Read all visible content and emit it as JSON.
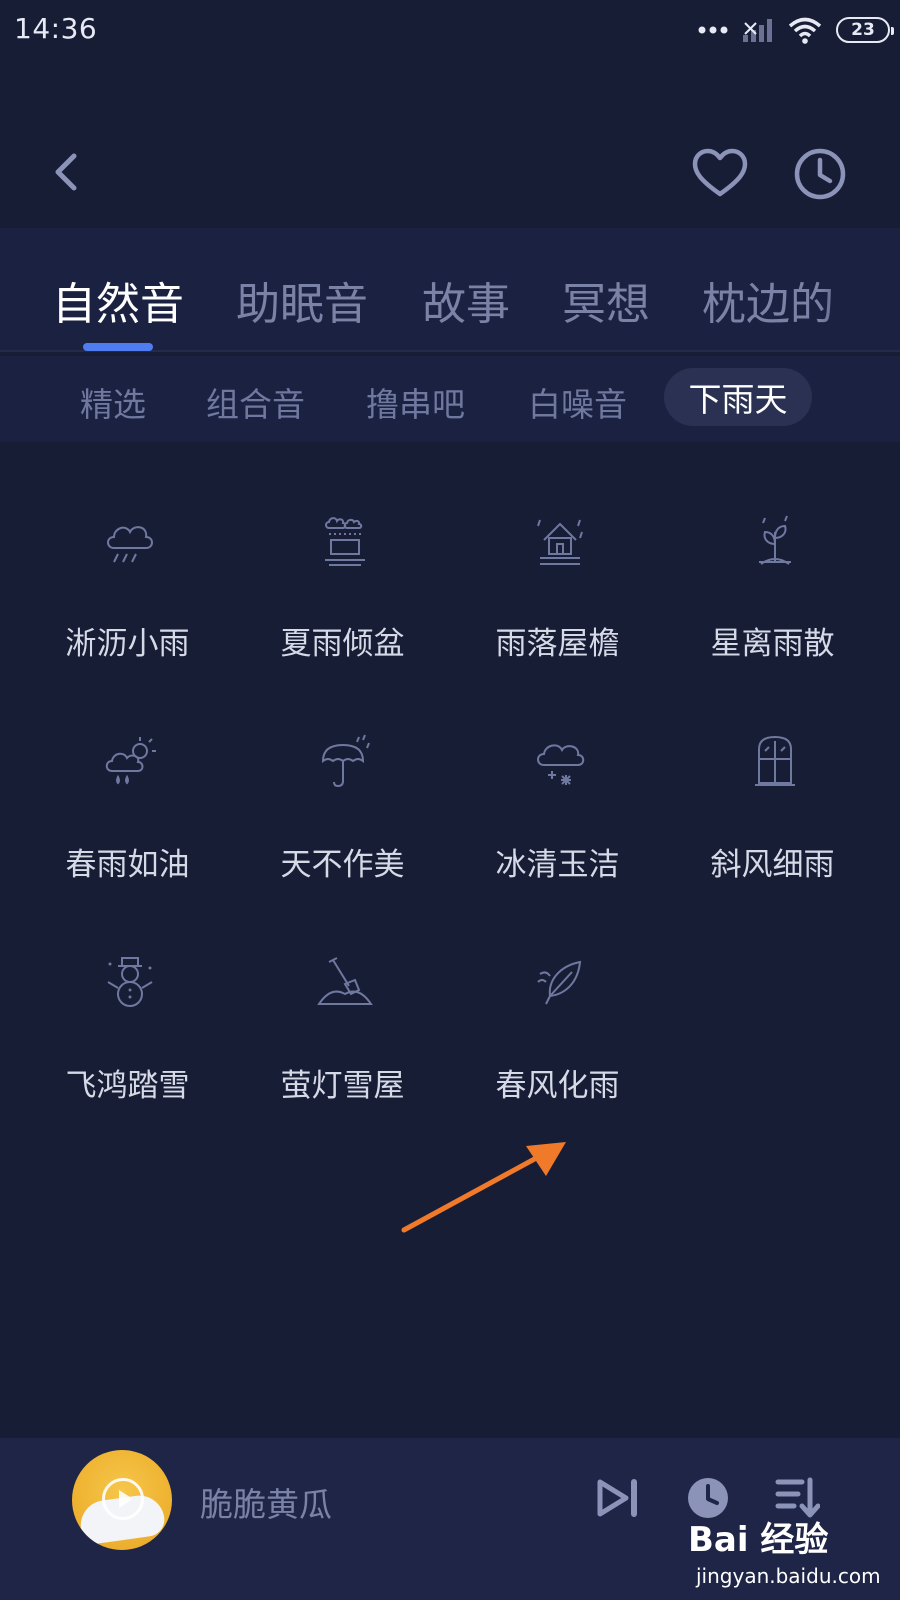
{
  "status_bar": {
    "time": "14:36",
    "battery": "23"
  },
  "icons": {
    "back": "chevron-left-icon",
    "favorite": "heart-icon",
    "history": "clock-icon"
  },
  "category_tabs": [
    {
      "label": "自然音",
      "active": true
    },
    {
      "label": "助眠音",
      "active": false
    },
    {
      "label": "故事",
      "active": false
    },
    {
      "label": "冥想",
      "active": false
    },
    {
      "label": "枕边的",
      "active": false
    }
  ],
  "sub_tabs": [
    {
      "label": "精选",
      "active": false
    },
    {
      "label": "组合音",
      "active": false
    },
    {
      "label": "撸串吧",
      "active": false
    },
    {
      "label": "白噪音",
      "active": false
    },
    {
      "label": "下雨天",
      "active": true
    }
  ],
  "sounds": [
    {
      "label": "淅沥小雨",
      "icon": "rain-cloud-icon"
    },
    {
      "label": "夏雨倾盆",
      "icon": "downpour-icon"
    },
    {
      "label": "雨落屋檐",
      "icon": "house-rain-icon"
    },
    {
      "label": "星离雨散",
      "icon": "sprout-rain-icon"
    },
    {
      "label": "春雨如油",
      "icon": "sun-cloud-rain-icon"
    },
    {
      "label": "天不作美",
      "icon": "umbrella-rain-icon"
    },
    {
      "label": "冰清玉洁",
      "icon": "snow-cloud-icon"
    },
    {
      "label": "斜风细雨",
      "icon": "window-icon"
    },
    {
      "label": "飞鸿踏雪",
      "icon": "snowman-icon"
    },
    {
      "label": "萤灯雪屋",
      "icon": "shovel-icon"
    },
    {
      "label": "春风化雨",
      "icon": "feather-icon"
    }
  ],
  "player": {
    "track": "脆脆黄瓜",
    "icons": [
      "play-next-icon",
      "timer-icon",
      "playlist-icon"
    ]
  },
  "colors": {
    "background": "#181d36",
    "accent": "#4f7cf0",
    "annotation_arrow": "#f07a2a"
  },
  "watermark": {
    "logo": "Bai 经验",
    "url": "jingyan.baidu.com"
  }
}
